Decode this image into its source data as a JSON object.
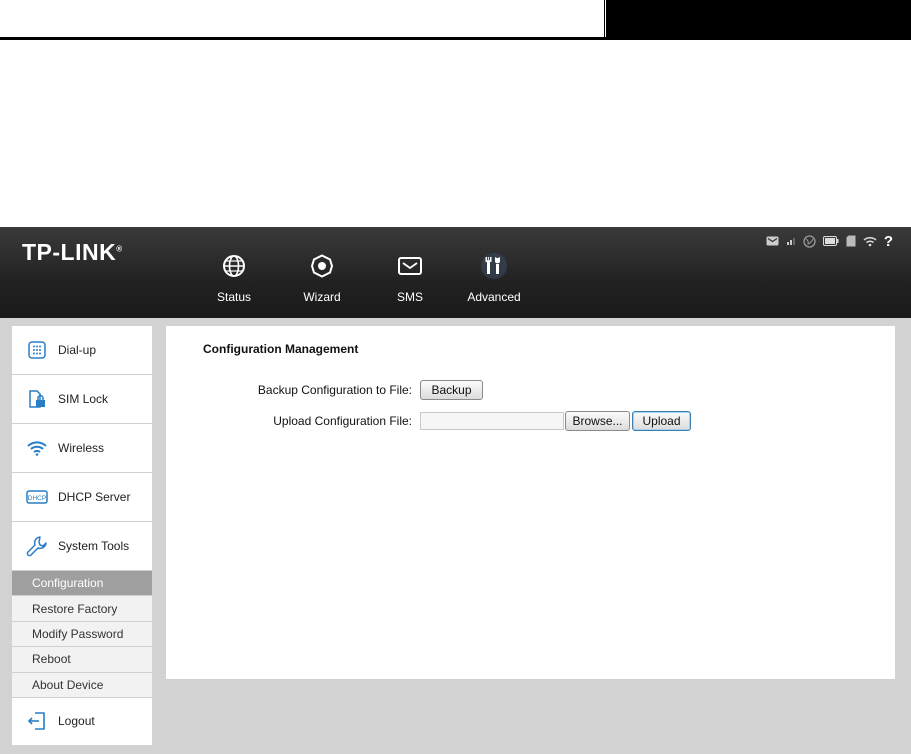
{
  "logo": {
    "text": "TP-LINK",
    "mark": "®"
  },
  "nav": [
    {
      "label": "Status",
      "icon": "globe-icon"
    },
    {
      "label": "Wizard",
      "icon": "wizard-gear-icon"
    },
    {
      "label": "SMS",
      "icon": "envelope-icon"
    },
    {
      "label": "Advanced",
      "icon": "tools-icon"
    }
  ],
  "status_icons": [
    "message-icon",
    "signal-icon",
    "internet-icon",
    "battery-icon",
    "sd-card-icon",
    "wifi-icon",
    "help-icon"
  ],
  "sidebar": {
    "items": [
      {
        "label": "Dial-up",
        "icon": "dialpad-icon"
      },
      {
        "label": "SIM Lock",
        "icon": "sim-lock-icon"
      },
      {
        "label": "Wireless",
        "icon": "wifi-icon"
      },
      {
        "label": "DHCP Server",
        "icon": "dhcp-icon"
      },
      {
        "label": "System Tools",
        "icon": "wrench-icon"
      }
    ],
    "sub_items": [
      {
        "label": "Configuration",
        "active": true
      },
      {
        "label": "Restore Factory",
        "active": false
      },
      {
        "label": "Modify Password",
        "active": false
      },
      {
        "label": "Reboot",
        "active": false
      },
      {
        "label": "About Device",
        "active": false
      }
    ],
    "logout": {
      "label": "Logout",
      "icon": "logout-icon"
    }
  },
  "main": {
    "title": "Configuration Management",
    "backup_label": "Backup Configuration to File:",
    "backup_button": "Backup",
    "upload_label": "Upload Configuration File:",
    "upload_value": "",
    "browse_button": "Browse...",
    "upload_button": "Upload"
  },
  "colors": {
    "topbar": "#222222",
    "content_bg": "#d2d2d2",
    "active_sub": "#9f9f9f",
    "accent": "#3c7fb1"
  }
}
